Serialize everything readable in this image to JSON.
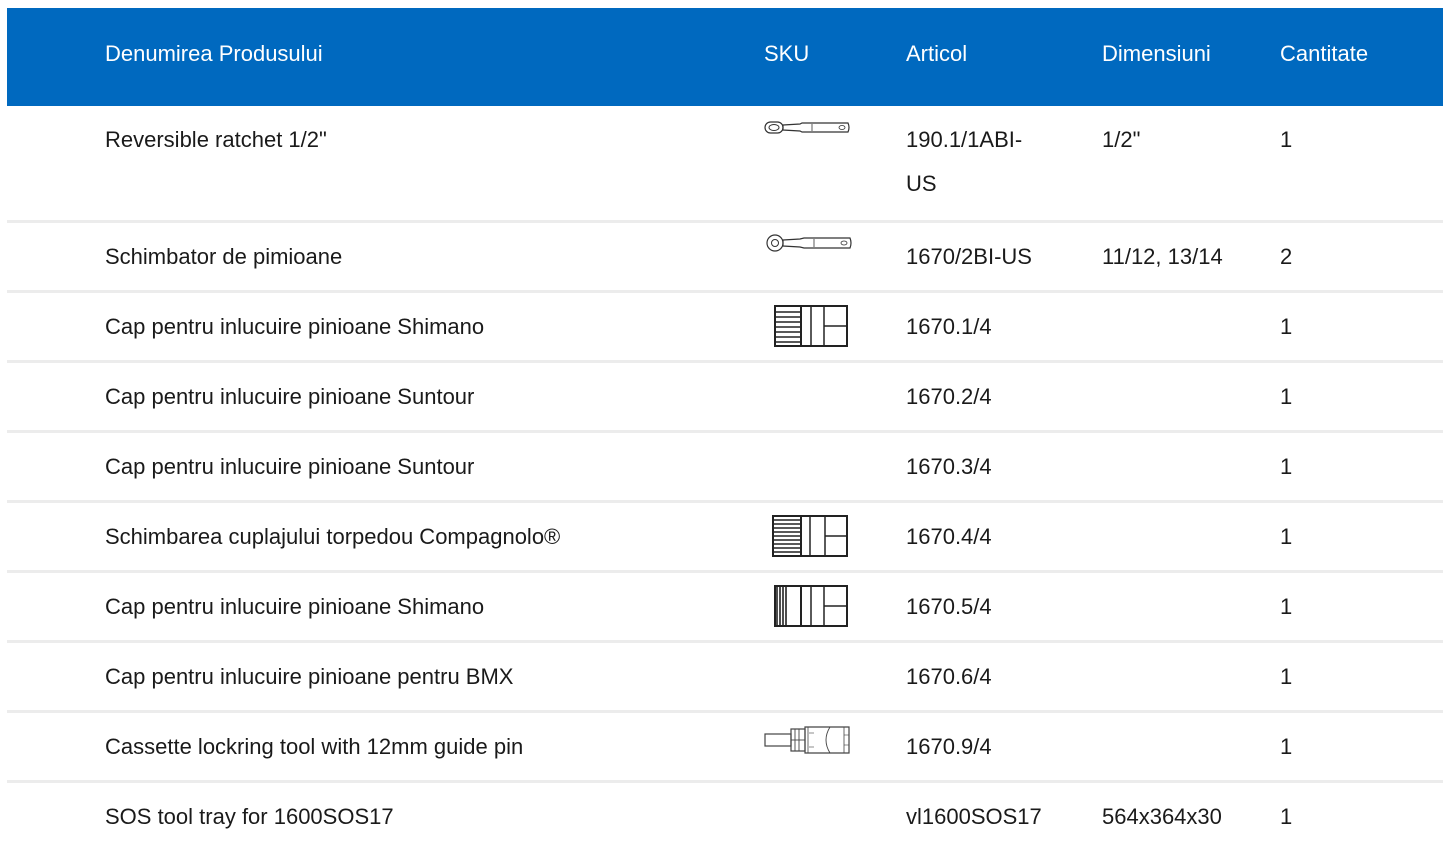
{
  "header": {
    "name": "Denumirea Produsului",
    "sku": "SKU",
    "article": "Articol",
    "dimensions": "Dimensiuni",
    "quantity": "Cantitate"
  },
  "rows": [
    {
      "name": "Reversible ratchet 1/2\"",
      "sku_icon": "reversible-ratchet-icon",
      "article_line1": "190.1/1ABI-",
      "article_line2": "US",
      "dimensions": "1/2\"",
      "quantity": "1"
    },
    {
      "name": "Schimbator de pimioane",
      "sku_icon": "ratchet-handle-icon",
      "article": "1670/2BI-US",
      "dimensions": "11/12, 13/14",
      "quantity": "2"
    },
    {
      "name": "Cap pentru inlucuire pinioane Shimano",
      "sku_icon": "splined-socket-icon",
      "article": "1670.1/4",
      "dimensions": "",
      "quantity": "1"
    },
    {
      "name": "Cap pentru inlucuire pinioane Suntour",
      "article": "1670.2/4",
      "dimensions": "",
      "quantity": "1"
    },
    {
      "name": "Cap pentru inlucuire pinioane Suntour",
      "article": "1670.3/4",
      "dimensions": "",
      "quantity": "1"
    },
    {
      "name": "Schimbarea cuplajului torpedou Compagnolo®",
      "sku_icon": "splined-socket-icon",
      "article": "1670.4/4",
      "dimensions": "",
      "quantity": "1"
    },
    {
      "name": "Cap pentru inlucuire pinioane Shimano",
      "sku_icon": "splined-socket-icon",
      "article": "1670.5/4",
      "dimensions": "",
      "quantity": "1"
    },
    {
      "name": "Cap pentru inlucuire pinioane pentru BMX",
      "article": "1670.6/4",
      "dimensions": "",
      "quantity": "1"
    },
    {
      "name": "Cassette lockring tool with 12mm guide pin",
      "sku_icon": "lockring-tool-icon",
      "article": "1670.9/4",
      "dimensions": "",
      "quantity": "1"
    },
    {
      "name": "SOS tool tray for 1600SOS17",
      "article": "vl1600SOS17",
      "dimensions": "564x364x30",
      "quantity": "1"
    }
  ],
  "colors": {
    "header_bg": "#0069bf",
    "header_text": "#ffffff",
    "divider": "#ececec"
  }
}
